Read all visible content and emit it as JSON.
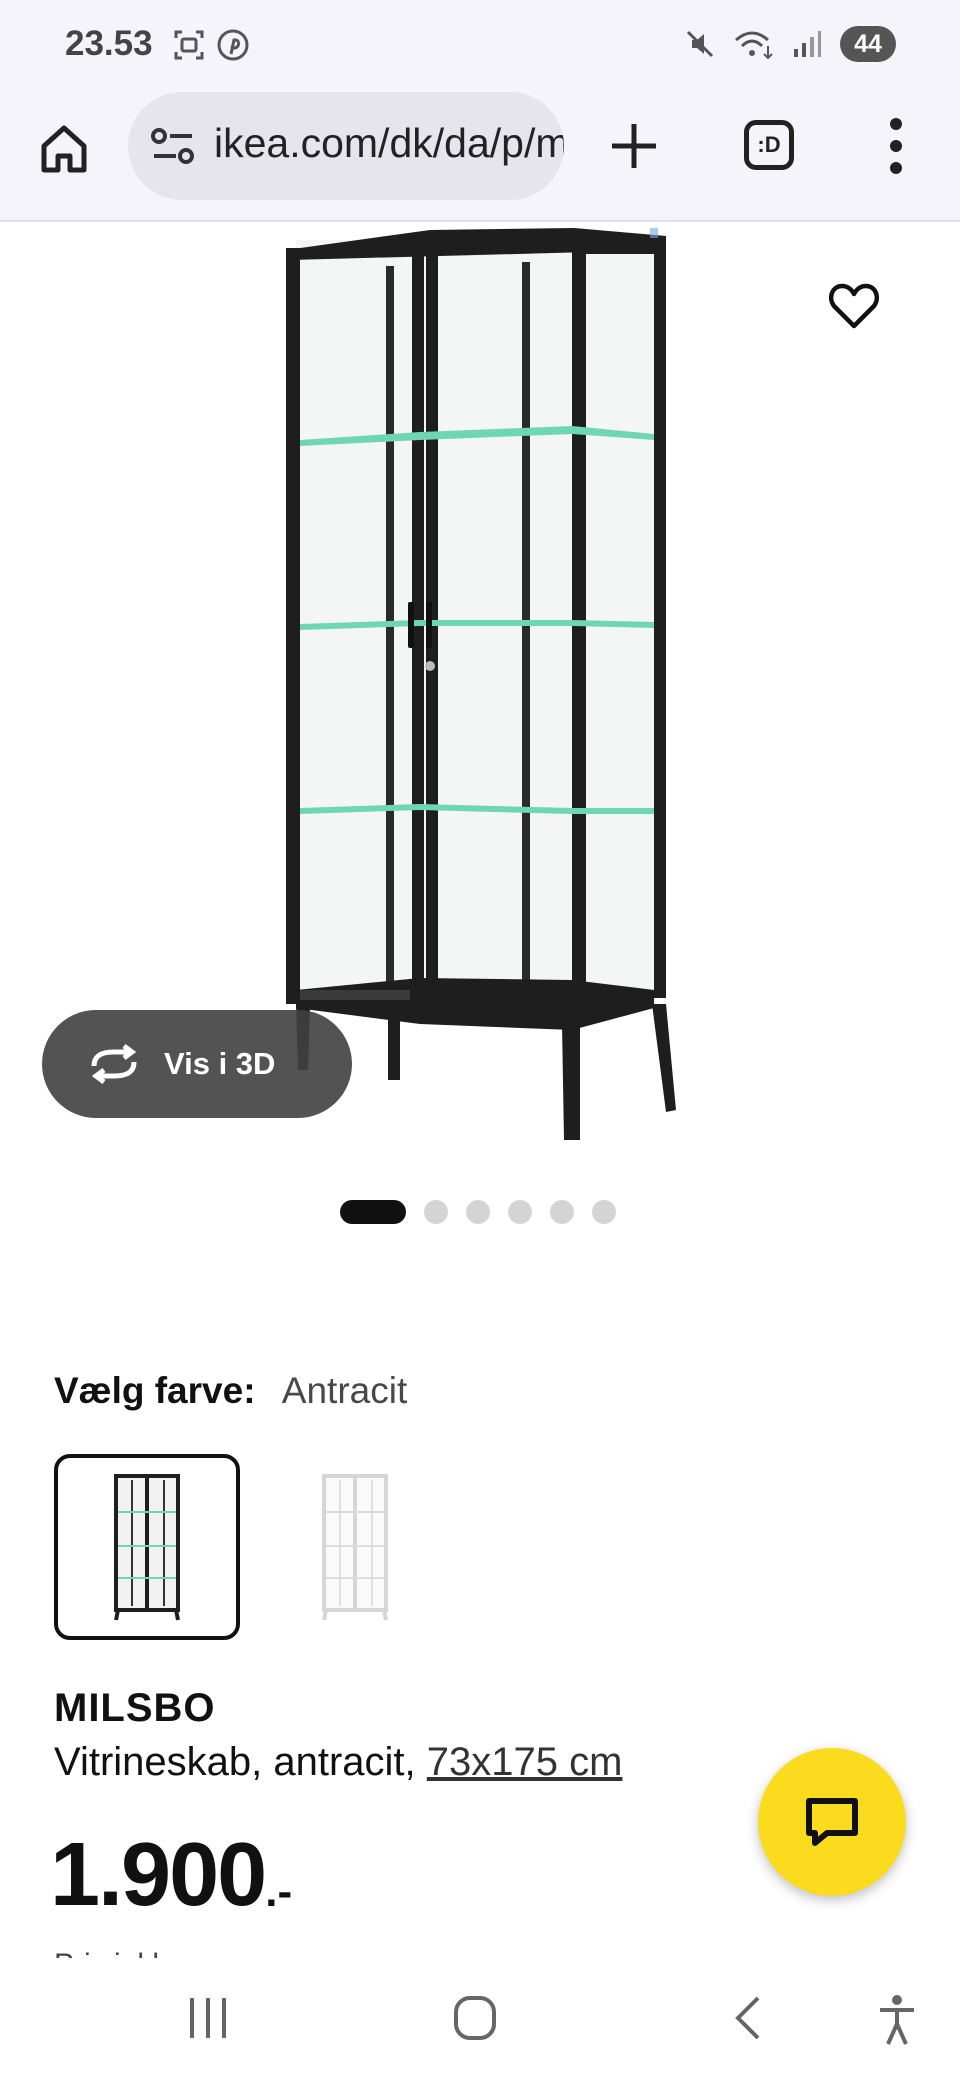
{
  "status_bar": {
    "time": "23.53",
    "battery": "44",
    "icons": [
      "screenshot-icon",
      "pinterest-icon",
      "mute-icon",
      "wifi-icon",
      "signal-icon"
    ]
  },
  "browser": {
    "url": "ikea.com/dk/da/p/milsbo",
    "tabs_label": ":D",
    "icons": [
      "home-icon",
      "site-settings-icon",
      "plus-icon",
      "tabs-icon",
      "more-vert-icon"
    ]
  },
  "product_gallery": {
    "view3d_label": "Vis i 3D",
    "slide_count": 6,
    "active_slide": 1,
    "icons": [
      "heart-icon",
      "rotate-3d-icon"
    ]
  },
  "color_picker": {
    "label": "Vælg farve:",
    "selected_value": "Antracit",
    "options": [
      "Antracit",
      "Hvid"
    ]
  },
  "product": {
    "name": "MILSBO",
    "description": "Vitrineskab, antracit, ",
    "size_link": "73x175 cm",
    "price_main": "1.900",
    "price_suffix": ".-",
    "cut_off_text": "Pris inkl. moms"
  },
  "chat": {
    "icon": "chat-bubble-icon"
  },
  "nav_bar": {
    "icons": [
      "recents-icon",
      "home-nav-icon",
      "back-icon",
      "accessibility-icon"
    ]
  },
  "colors": {
    "accent_yellow": "#fadb1e",
    "cabinet_antracit": "#1e1e1e",
    "cabinet_white": "#f2f2f2",
    "glass_shelf": "#6fd6b4"
  }
}
